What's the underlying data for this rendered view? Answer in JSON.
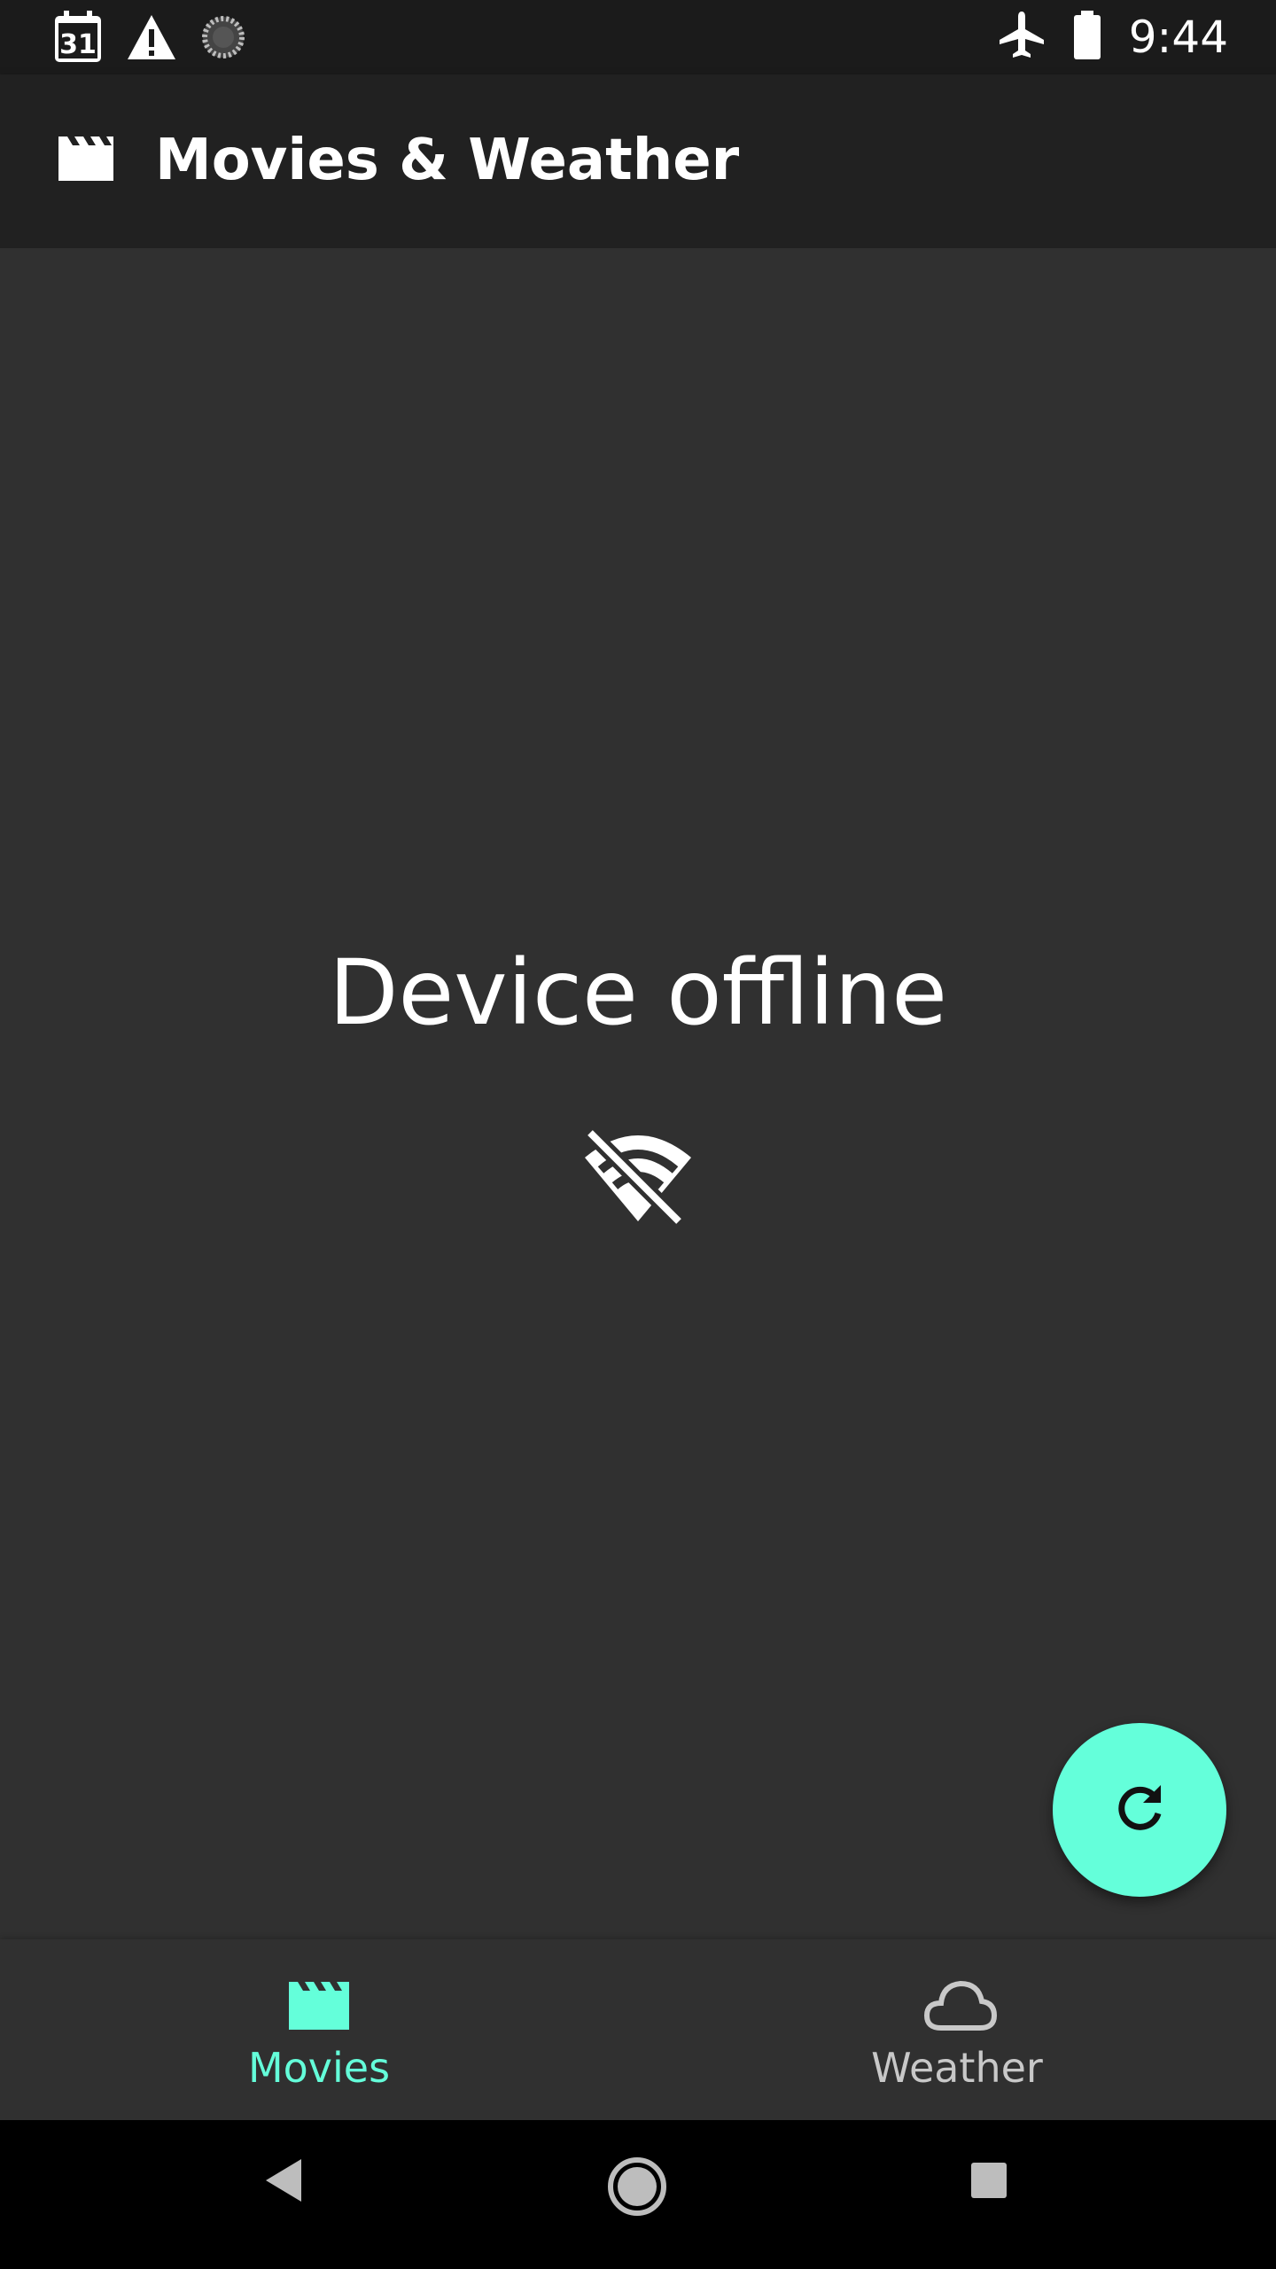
{
  "status_bar": {
    "calendar_icon": "calendar-icon",
    "calendar_day": "31",
    "warning_icon": "warning-icon",
    "loading_icon": "loading-icon",
    "airplane_icon": "airplane-icon",
    "battery_icon": "battery-icon",
    "time": "9:44"
  },
  "app_bar": {
    "icon": "movie-clapper-icon",
    "title": "Movies & Weather"
  },
  "content": {
    "message": "Device offline",
    "icon": "wifi-off-icon"
  },
  "fab": {
    "icon": "refresh-icon"
  },
  "bottom_nav": {
    "items": [
      {
        "label": "Movies",
        "icon": "movie-clapper-icon",
        "selected": true
      },
      {
        "label": "Weather",
        "icon": "cloud-icon",
        "selected": false
      }
    ]
  },
  "system_nav": {
    "back": "back-icon",
    "home": "home-icon",
    "recents": "recents-icon"
  },
  "colors": {
    "accent": "#64ffda",
    "app_bar": "#212121",
    "background": "#303030",
    "status_bar": "#1b1b1b"
  }
}
